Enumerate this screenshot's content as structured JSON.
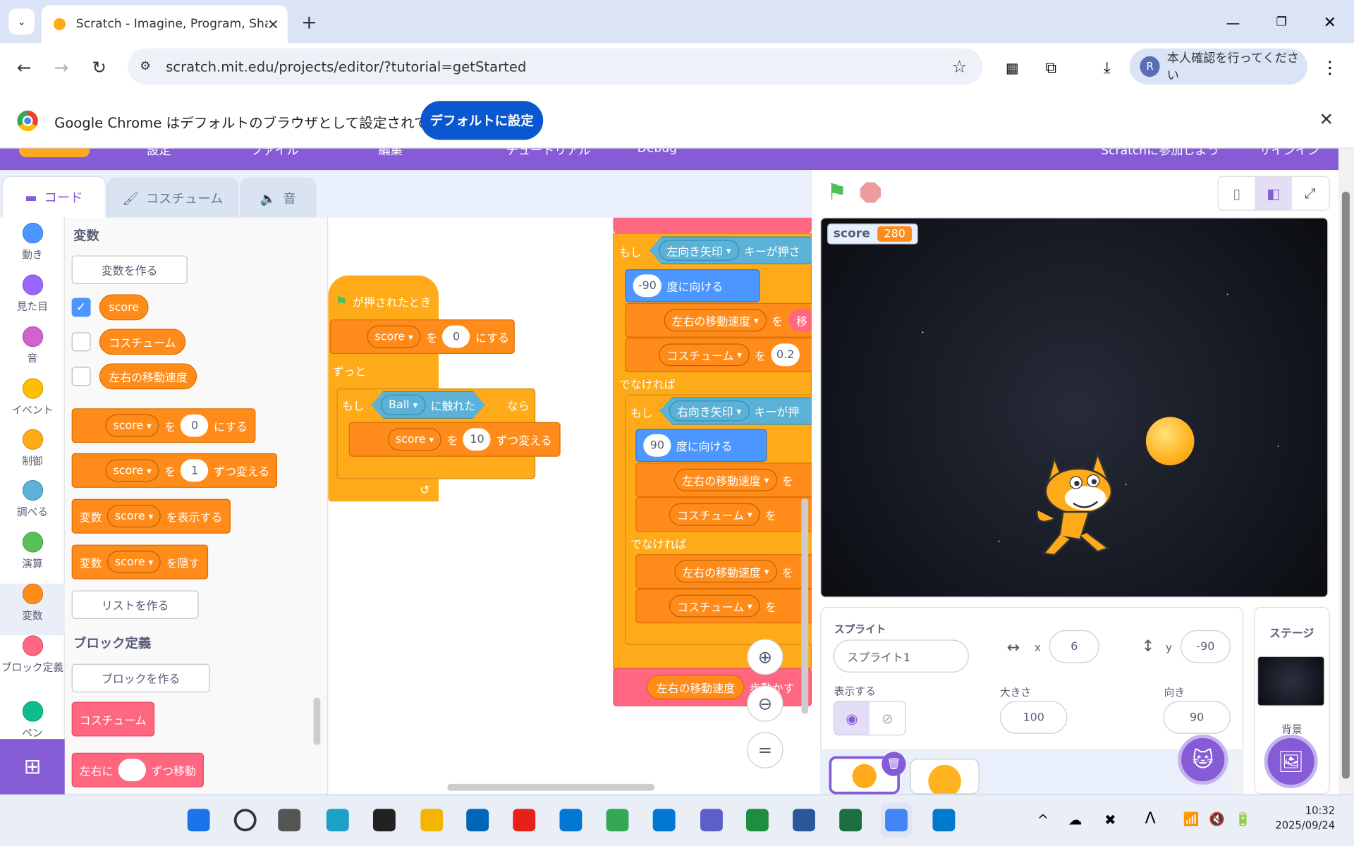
{
  "browser": {
    "tab_title": "Scratch - Imagine, Program, Sha",
    "url": "scratch.mit.edu/projects/editor/?tutorial=getStarted",
    "profile_label": "本人確認を行ってください",
    "profile_initial": "R"
  },
  "infobar": {
    "message": "Google Chrome はデフォルトのブラウザとして設定されていません",
    "button": "デフォルトに設定"
  },
  "menu": [
    "設定",
    "ファイル",
    "編集",
    "チュートリアル",
    "Debug",
    "Scratchに参加しよう",
    "サインイン"
  ],
  "editor_tabs": [
    "コード",
    "コスチューム",
    "音"
  ],
  "categories": [
    {
      "label": "動き",
      "color": "#4c97ff"
    },
    {
      "label": "見た目",
      "color": "#9966ff"
    },
    {
      "label": "音",
      "color": "#cf63cf"
    },
    {
      "label": "イベント",
      "color": "#ffbf00"
    },
    {
      "label": "制御",
      "color": "#ffab19"
    },
    {
      "label": "調べる",
      "color": "#5cb1d6"
    },
    {
      "label": "演算",
      "color": "#59c059"
    },
    {
      "label": "変数",
      "color": "#ff8c1a"
    },
    {
      "label": "ブロック定義",
      "color": "#ff6680"
    },
    {
      "label": "ペン",
      "color": "#0fbd8c"
    }
  ],
  "palette": {
    "title_vars": "変数",
    "make_var": "変数を作る",
    "vars": [
      {
        "name": "score",
        "checked": true
      },
      {
        "name": "コスチューム",
        "checked": false
      },
      {
        "name": "左右の移動速度",
        "checked": false
      }
    ],
    "set_block": {
      "var": "score",
      "to": "を",
      "val": "0",
      "end": "にする"
    },
    "change_block": {
      "var": "score",
      "to": "を",
      "val": "1",
      "end": "ずつ変える"
    },
    "show_block": {
      "head": "変数",
      "var": "score",
      "end": "を表示する"
    },
    "hide_block": {
      "head": "変数",
      "var": "score",
      "end": "を隠す"
    },
    "make_list": "リストを作る",
    "title_defs": "ブロック定義",
    "make_block": "ブロックを作る",
    "def_costume": "コスチューム",
    "def_move": {
      "a": "左右に",
      "b": "ずつ移動"
    }
  },
  "script1": {
    "hat": "が押されたとき",
    "set": {
      "var": "score",
      "to": "を",
      "val": "0",
      "end": "にする"
    },
    "forever": "ずっと",
    "if": "もし",
    "touch_target": "Ball",
    "touch_label": "に触れた",
    "then": "なら",
    "change": {
      "var": "score",
      "to": "を",
      "val": "10",
      "end": "ずつ変える"
    }
  },
  "script2": {
    "if1": "もし",
    "key1": "左向き矢印",
    "key_label": "キーが押さ",
    "dir1": "-90",
    "dir_label": "度に向ける",
    "speed_var": "左右の移動速度",
    "to": "を",
    "trunc1": "移",
    "costume_var": "コスチューム",
    "costume_val": "0.2",
    "else1": "でなければ",
    "if2": "もし",
    "key2": "右向き矢印",
    "key_label2": "キーが押",
    "dir2": "90",
    "else2": "でなければ",
    "move_reporter": "左右の移動速度",
    "move_label": "歩動かす"
  },
  "stage": {
    "monitor_label": "score",
    "monitor_value": "280"
  },
  "sprite": {
    "label": "スプライト",
    "name": "スプライト1",
    "x_label": "x",
    "x": "6",
    "y_label": "y",
    "y": "-90",
    "show_label": "表示する",
    "size_label": "大きさ",
    "size": "100",
    "dir_label": "向き",
    "dir": "90"
  },
  "backdrop": {
    "title": "ステージ",
    "label": "背景"
  },
  "clock": {
    "time": "10:32",
    "date": "2025/09/24"
  }
}
